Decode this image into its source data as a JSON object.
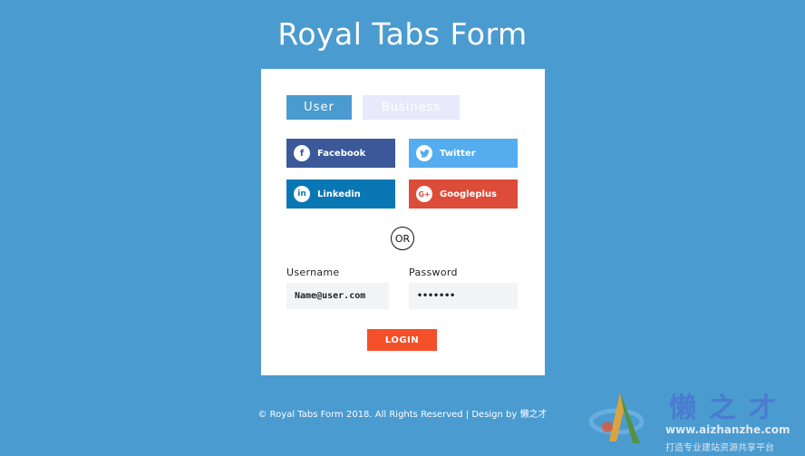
{
  "title": "Royal Tabs Form",
  "tabs": [
    {
      "label": "User",
      "active": true
    },
    {
      "label": "Business",
      "active": false
    }
  ],
  "social": {
    "facebook": {
      "label": "Facebook",
      "icon": "facebook-icon",
      "glyph": "f",
      "color": "#3b5998"
    },
    "twitter": {
      "label": "Twitter",
      "icon": "twitter-icon",
      "glyph": "t",
      "color": "#55acee"
    },
    "linkedin": {
      "label": "Linkedin",
      "icon": "linkedin-icon",
      "glyph": "in",
      "color": "#0a77b5"
    },
    "googleplus": {
      "label": "Googleplus",
      "icon": "googleplus-icon",
      "glyph": "G+",
      "color": "#dd4b39"
    }
  },
  "divider_text": "OR",
  "form": {
    "username_label": "Username",
    "username_value": "Name@user.com",
    "password_label": "Password",
    "password_value": "•••••••",
    "login_label": "LOGIN"
  },
  "footer": {
    "text": "© Royal Tabs Form 2018. All Rights Reserved | Design by",
    "link": "懒之才"
  },
  "watermark": {
    "title": "懒之才",
    "url": "www.aizhanzhe.com",
    "subtitle": "打造专业建站资源共享平台"
  },
  "colors": {
    "background": "#4a9bd0",
    "card": "#ffffff",
    "accent": "#4a9bd0",
    "login": "#f4502a"
  }
}
